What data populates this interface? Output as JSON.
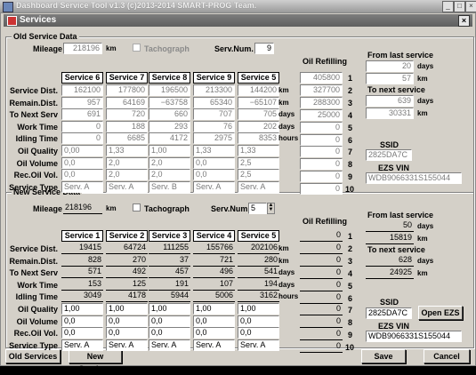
{
  "window_title": "Dashboard Service Tool v1.3 (c)2013-2014 SMART-PROG Team.",
  "subtitle": "Services",
  "old": {
    "group_label": "Old Service Data",
    "mileage_label": "Mileage",
    "mileage": "218196",
    "mileage_unit": "km",
    "tachograph_label": "Tachograph",
    "servnum_label": "Serv.Num.",
    "servnum": "9",
    "services": [
      "Service 6",
      "Service 7",
      "Service 8",
      "Service 9",
      "Service 5"
    ],
    "row_labels": [
      "Service Dist.",
      "Remain.Dist.",
      "To Next Serv",
      "Work Time",
      "Idling Time",
      "Oil Quality",
      "Oil Volume",
      "Rec.Oil Vol.",
      "Service Type"
    ],
    "row_units": [
      "km",
      "km",
      "days",
      "days",
      "hours",
      "",
      "",
      "",
      ""
    ],
    "rows": [
      [
        "162100",
        "177800",
        "196500",
        "213300",
        "144200"
      ],
      [
        "957",
        "64169",
        "−63758",
        "65340",
        "−65107"
      ],
      [
        "691",
        "720",
        "660",
        "707",
        "705"
      ],
      [
        "0",
        "188",
        "293",
        "76",
        "202"
      ],
      [
        "0",
        "6685",
        "4172",
        "2975",
        "8353"
      ],
      [
        "0,00",
        "1,33",
        "1,00",
        "1,33",
        "1,33"
      ],
      [
        "0,0",
        "2,0",
        "2,0",
        "0,0",
        "2,5"
      ],
      [
        "0,0",
        "2,0",
        "2,0",
        "0,0",
        "2,5"
      ],
      [
        "Serv. A",
        "Serv. A",
        "Serv. B",
        "Serv. A",
        "Serv. A"
      ]
    ],
    "oil_label": "Oil Refilling",
    "oil": [
      "405800",
      "327700",
      "288300",
      "25000",
      "0",
      "0",
      "0",
      "0",
      "0",
      "0"
    ],
    "from_last_label": "From last service",
    "from_last_days": "20",
    "days_unit": "days",
    "from_last_km": "57",
    "km_unit": "km",
    "to_next_label": "To next service",
    "to_next_days": "639",
    "to_next_km": "30331",
    "ssid_label": "SSID",
    "ssid": "2825DA7C",
    "vin_label": "EZS VIN",
    "vin": "WDB9066331S155044"
  },
  "new": {
    "group_label": "New Service Data",
    "mileage_label": "Mileage",
    "mileage": "218196",
    "mileage_unit": "km",
    "tachograph_label": "Tachograph",
    "servnum_label": "Serv.Num.",
    "servnum": "5",
    "services": [
      "Service 1",
      "Service 2",
      "Service 3",
      "Service 4",
      "Service 5"
    ],
    "row_labels": [
      "Service Dist.",
      "Remain.Dist.",
      "To Next Serv",
      "Work Time",
      "Idling Time",
      "Oil Quality",
      "Oil Volume",
      "Rec.Oil Vol.",
      "Service Type"
    ],
    "row_units": [
      "km",
      "km",
      "days",
      "days",
      "hours",
      "",
      "",
      "",
      ""
    ],
    "rows": [
      [
        "19415",
        "64724",
        "111255",
        "155766",
        "202106"
      ],
      [
        "828",
        "270",
        "37",
        "721",
        "280"
      ],
      [
        "571",
        "492",
        "457",
        "496",
        "541"
      ],
      [
        "153",
        "125",
        "191",
        "107",
        "194"
      ],
      [
        "3049",
        "4178",
        "5944",
        "5006",
        "3162"
      ],
      [
        "1,00",
        "1,00",
        "1,00",
        "1,00",
        "1,00"
      ],
      [
        "0,0",
        "0,0",
        "0,0",
        "0,0",
        "0,0"
      ],
      [
        "0,0",
        "0,0",
        "0,0",
        "0,0",
        "0,0"
      ],
      [
        "Serv. A",
        "Serv. A",
        "Serv. A",
        "Serv. A",
        "Serv. A"
      ]
    ],
    "oil_label": "Oil Refilling",
    "oil": [
      "0",
      "0",
      "0",
      "0",
      "0",
      "0",
      "0",
      "0",
      "0",
      "0"
    ],
    "from_last_label": "From last service",
    "from_last_days": "50",
    "days_unit": "days",
    "from_last_km": "15819",
    "km_unit": "km",
    "to_next_label": "To next service",
    "to_next_days": "628",
    "to_next_km": "24925",
    "ssid_label": "SSID",
    "ssid": "2825DA7C",
    "open_ezs_label": "Open EZS",
    "vin_label": "EZS VIN",
    "vin": "WDB9066331S155044"
  },
  "row_numbers": [
    "1",
    "2",
    "3",
    "4",
    "5",
    "6",
    "7",
    "8",
    "9",
    "10"
  ],
  "buttons": {
    "old_services": "Old Services",
    "new_services": "New Services",
    "save": "Save",
    "cancel": "Cancel"
  }
}
